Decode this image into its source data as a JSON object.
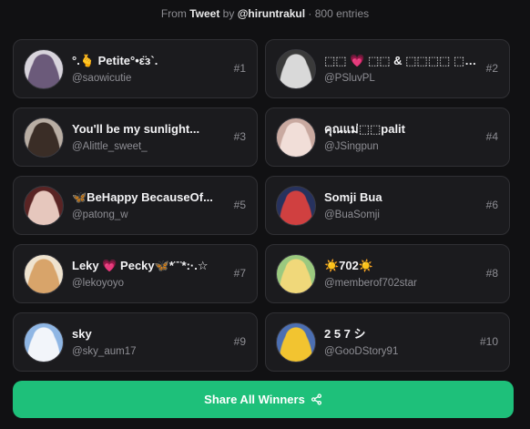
{
  "header": {
    "from": "From",
    "source": "Tweet",
    "by": "by",
    "author": "@hiruntrakul",
    "entries": "· 800 entries"
  },
  "winners": [
    {
      "name": "°.🫰 Petite°•ε̈з`.",
      "handle": "@saowicutie",
      "rank": "#1",
      "avatar_bg": "#d8d4dc",
      "avatar_fg": "#6b5a7a",
      "avatar_icon": "user-photo-icon"
    },
    {
      "name": "⬚⬚ 💗 ⬚⬚ & ⬚⬚⬚⬚ ⬚⬚⬚⬚",
      "handle": "@PSluvPL",
      "rank": "#2",
      "avatar_bg": "#3a3a3a",
      "avatar_fg": "#d9d9d9",
      "avatar_icon": "user-photo-icon"
    },
    {
      "name": "You'll be my sunlight...",
      "handle": "@Alittle_sweet_",
      "rank": "#3",
      "avatar_bg": "#b9aea4",
      "avatar_fg": "#3a2d26",
      "avatar_icon": "user-photo-icon"
    },
    {
      "name": "คุณแม่⬚⬚palit",
      "handle": "@JSingpun",
      "rank": "#4",
      "avatar_bg": "#c9a9a0",
      "avatar_fg": "#f1ded8",
      "avatar_icon": "user-photo-icon"
    },
    {
      "name": "🦋BeHappy BecauseOf...",
      "handle": "@patong_w",
      "rank": "#5",
      "avatar_bg": "#5a2424",
      "avatar_fg": "#e6c7bd",
      "avatar_icon": "user-photo-icon"
    },
    {
      "name": "Somji Bua",
      "handle": "@BuaSomji",
      "rank": "#6",
      "avatar_bg": "#27325e",
      "avatar_fg": "#d04040",
      "avatar_icon": "user-photo-icon"
    },
    {
      "name": "Leky 💗 Pecky🦋*¨¨*:·.☆",
      "handle": "@lekoyoyo",
      "rank": "#7",
      "avatar_bg": "#efe3cf",
      "avatar_fg": "#d8a46a",
      "avatar_icon": "user-photo-icon"
    },
    {
      "name": "☀️702☀️",
      "handle": "@memberof702star",
      "rank": "#8",
      "avatar_bg": "#9bc97f",
      "avatar_fg": "#f0d87a",
      "avatar_icon": "user-photo-icon"
    },
    {
      "name": "sky",
      "handle": "@sky_aum17",
      "rank": "#9",
      "avatar_bg": "#8fb6e4",
      "avatar_fg": "#f2f5fa",
      "avatar_icon": "user-photo-icon"
    },
    {
      "name": "2 5 7 シ",
      "handle": "@GooDStory91",
      "rank": "#10",
      "avatar_bg": "#4c6fb2",
      "avatar_fg": "#f2c430",
      "avatar_icon": "user-photo-icon"
    }
  ],
  "share": {
    "label": "Share All Winners",
    "icon": "share-icon",
    "color": "#1ec07a"
  }
}
